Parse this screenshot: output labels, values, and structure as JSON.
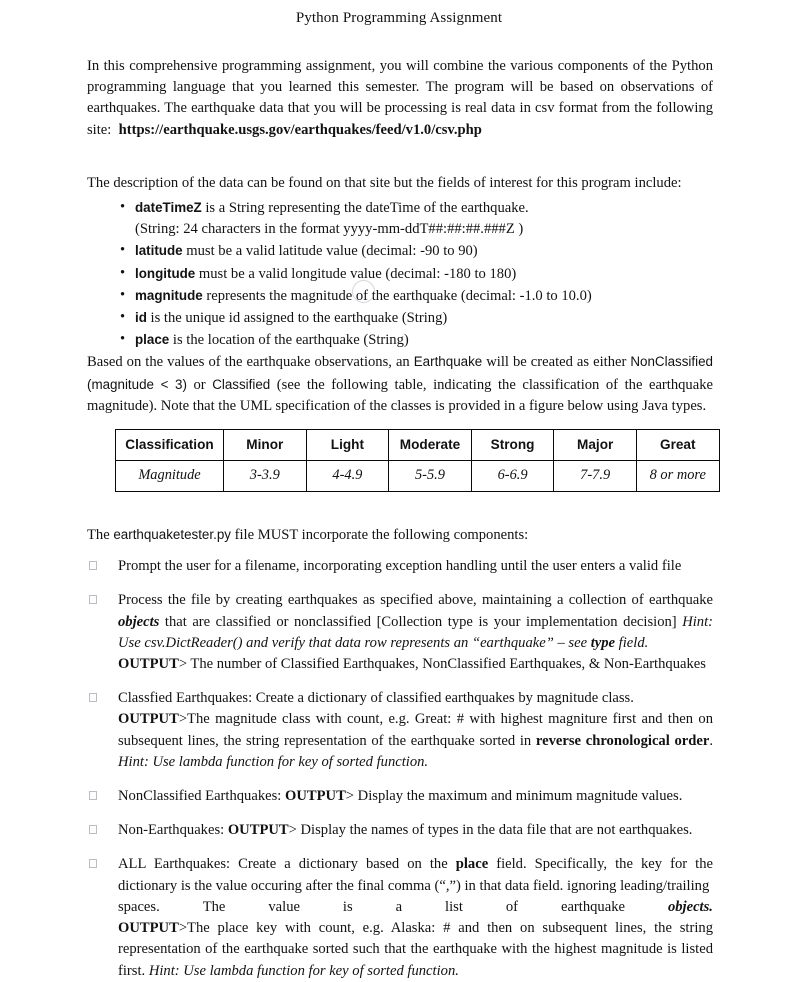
{
  "document": {
    "title": "Python Programming Assignment",
    "intro": {
      "text_before_url": "In this comprehensive programming assignment, you will combine the various components of the Python programming language that you learned this semester. The program will be based on observations of earthquakes. The earthquake data that you will be processing is real data in csv format from the following site:",
      "url": "https://earthquake.usgs.gov/earthquakes/feed/v1.0/csv.php"
    },
    "fields_intro": "The description of the data can be found on that site but the fields of interest for this program include:",
    "fields": [
      {
        "name": "dateTimeZ",
        "description": " is a String representing the dateTime of the earthquake.",
        "subline": "(String: 24 characters in the format yyyy-mm-ddT##:##:##.###Z )"
      },
      {
        "name": "latitude",
        "description": " must be a valid latitude value (decimal: -90 to 90)",
        "subline": ""
      },
      {
        "name": "longitude",
        "description": " must be a valid longitude value (decimal: -180 to 180)",
        "subline": ""
      },
      {
        "name": "magnitude",
        "description": " represents the magnitude of the earthquake (decimal: -1.0 to 10.0)",
        "subline": ""
      },
      {
        "name": "id",
        "description": " is the unique id assigned to the earthquake (String)",
        "subline": ""
      },
      {
        "name": "place",
        "description": " is the location of the earthquake (String)",
        "subline": ""
      }
    ],
    "classification_para": {
      "seg1": "Based on the values of the earthquake observations, an ",
      "term1": "Earthquake",
      "seg2": " will be created as either ",
      "term2": "NonClassified (magnitude < 3)",
      "seg3": " or ",
      "term3": "Classified",
      "seg4": " (see the following table, indicating the classification of the earthquake magnitude). Note that the UML specification of the classes is provided in a figure below using Java types."
    },
    "components_intro": {
      "seg1": "The ",
      "filename": "earthquaketester.py",
      "seg2": " file MUST incorporate the following components:"
    }
  },
  "classification_table": {
    "headers": [
      "Classification",
      "Minor",
      "Light",
      "Moderate",
      "Strong",
      "Major",
      "Great"
    ],
    "values": [
      "Magnitude",
      "3-3.9",
      "4-4.9",
      "5-5.9",
      "6-6.9",
      "7-7.9",
      "8 or more"
    ]
  },
  "tasks": [
    {
      "id": "task-prompt-filename",
      "lines": [
        {
          "parts": [
            {
              "t": "Prompt the user for a filename, incorporating exception handling until the user enters a valid file",
              "s": "plain"
            }
          ]
        }
      ]
    },
    {
      "id": "task-process-file",
      "lines": [
        {
          "parts": [
            {
              "t": "Process the file by creating earthquakes as specified above, maintaining a collection of earthquake ",
              "s": "plain"
            },
            {
              "t": "objects",
              "s": "bold-italic"
            },
            {
              "t": " that are classified or nonclassified [Collection type is your implementation decision] ",
              "s": "plain"
            },
            {
              "t": "Hint: Use csv.DictReader() and verify that data row represents an “earthquake” – see ",
              "s": "italic"
            },
            {
              "t": "type",
              "s": "bold-italic"
            },
            {
              "t": " field.",
              "s": "italic"
            }
          ]
        },
        {
          "parts": [
            {
              "t": "OUTPUT",
              "s": "bold"
            },
            {
              "t": "> The number of Classified Earthquakes, NonClassified Earthquakes, & Non-Earthquakes",
              "s": "plain"
            }
          ]
        }
      ]
    },
    {
      "id": "task-classified-earthquakes",
      "lines": [
        {
          "parts": [
            {
              "t": "Classfied Earthquakes: Create a dictionary of classified earthquakes by magnitude class. ",
              "s": "plain"
            }
          ]
        },
        {
          "parts": [
            {
              "t": "OUTPUT",
              "s": "bold"
            },
            {
              "t": ">The magnitude class with count, e.g. Great: # with highest magniture first and then on subsequent lines, the string representation of the earthquake sorted in ",
              "s": "plain"
            },
            {
              "t": "reverse chronological order",
              "s": "bold"
            },
            {
              "t": ". ",
              "s": "plain"
            },
            {
              "t": "Hint: Use lambda function for key of sorted function.",
              "s": "italic"
            }
          ]
        }
      ]
    },
    {
      "id": "task-nonclassified-earthquakes",
      "lines": [
        {
          "parts": [
            {
              "t": "NonClassified Earthquakes: ",
              "s": "plain"
            },
            {
              "t": "OUTPUT",
              "s": "bold"
            },
            {
              "t": "> Display the maximum and minimum magnitude values.",
              "s": "plain"
            }
          ]
        }
      ]
    },
    {
      "id": "task-non-earthquakes",
      "lines": [
        {
          "parts": [
            {
              "t": "Non-Earthquakes: ",
              "s": "plain"
            },
            {
              "t": "OUTPUT",
              "s": "bold"
            },
            {
              "t": "> Display the names of types in the data file that are not earthquakes.",
              "s": "plain"
            }
          ]
        }
      ]
    },
    {
      "id": "task-all-earthquakes",
      "lines": [
        {
          "parts": [
            {
              "t": "ALL Earthquakes: Create a dictionary based on the ",
              "s": "plain"
            },
            {
              "t": "place",
              "s": "bold"
            },
            {
              "t": " field. Specifically, the key for the dictionary is the value occuring after the final comma (“,”) in that data field. ignoring leading/trailing",
              "s": "plain"
            }
          ]
        }
      ],
      "stretched_line": [
        "spaces.",
        "The",
        "value",
        "is",
        "a",
        "list",
        "of",
        "earthquake",
        "objects."
      ],
      "tail_lines": [
        {
          "parts": [
            {
              "t": "OUTPUT",
              "s": "bold"
            },
            {
              "t": ">The place key with count, e.g. Alaska: # and then on subsequent lines, the string representation of the earthquake sorted such that the earthquake with the highest magnitude is listed first. ",
              "s": "plain"
            },
            {
              "t": "Hint: Use lambda function for key of sorted function.",
              "s": "italic"
            }
          ]
        }
      ]
    }
  ]
}
